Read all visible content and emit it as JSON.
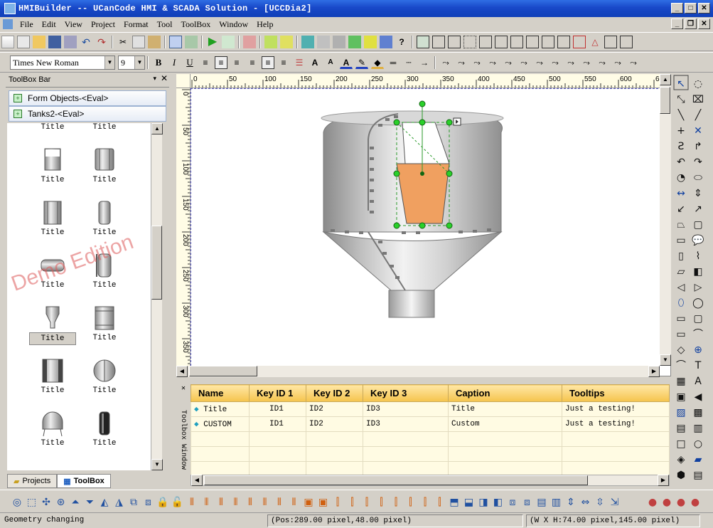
{
  "window": {
    "title": "HMIBuilder -- UCanCode HMI & SCADA Solution - [UCCDia2]"
  },
  "menu": [
    "File",
    "Edit",
    "View",
    "Project",
    "Format",
    "Tool",
    "ToolBox",
    "Window",
    "Help"
  ],
  "format_bar": {
    "font": "Times New Roman",
    "size": "9"
  },
  "toolbox": {
    "title": "ToolBox Bar",
    "groups": [
      "Form Objects-<Eval>",
      "Tanks2-<Eval>"
    ],
    "items": [
      {
        "label": "Title"
      },
      {
        "label": "Title"
      },
      {
        "label": "Title"
      },
      {
        "label": "Title"
      },
      {
        "label": "Title"
      },
      {
        "label": "Title"
      },
      {
        "label": "Title"
      },
      {
        "label": "Title"
      },
      {
        "label": "Title"
      },
      {
        "label": "Title"
      },
      {
        "label": "Title"
      },
      {
        "label": "Title"
      }
    ],
    "watermark": "Demo Edition",
    "tabs": [
      "Projects",
      "ToolBox"
    ]
  },
  "ruler": {
    "h_ticks": [
      "0",
      "50",
      "100",
      "150",
      "200",
      "250",
      "300",
      "350",
      "400",
      "450",
      "500",
      "550",
      "600",
      "6"
    ],
    "v_ticks": [
      "0",
      "50",
      "100",
      "150",
      "200",
      "250",
      "300",
      "350"
    ]
  },
  "toolbox_window": {
    "label": "Toolbox Window",
    "columns": [
      "Name",
      "Key ID 1",
      "Key ID 2",
      "Key ID 3",
      "Caption",
      "Tooltips"
    ],
    "rows": [
      [
        "Title",
        "ID1",
        "ID2",
        "ID3",
        "Title",
        "Just a testing!"
      ],
      [
        "CUSTOM",
        "ID1",
        "ID2",
        "ID3",
        "Custom",
        "Just a testing!"
      ]
    ]
  },
  "status": {
    "message": "Geometry changing",
    "pos": "(Pos:289.00 pixel,48.00 pixel)",
    "size": "(W X H:74.00 pixel,145.00 pixel)"
  },
  "colors": {
    "titlebar": "#1848c8",
    "fill": "#f0a060",
    "table_header": "#f5c44d"
  }
}
